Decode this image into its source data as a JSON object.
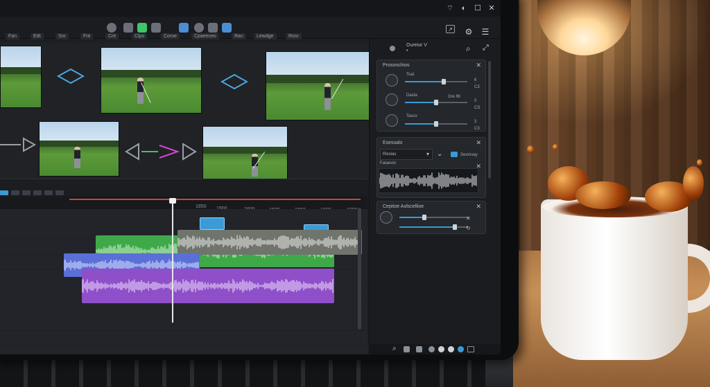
{
  "window": {
    "controls": {
      "wifi": "⌔",
      "theme": "◐",
      "maximize": "☐",
      "close": "✕"
    }
  },
  "toolbar": {
    "tools": [
      "pin-icon",
      "clip-icon",
      "timeline-icon",
      "cloud-icon",
      "image-icon",
      "gear-icon",
      "monitor-icon"
    ],
    "right_icons": [
      "export-icon",
      "settings-icon",
      "menu-icon"
    ]
  },
  "menu": {
    "items": [
      "Fan",
      "Edt",
      "Snr",
      "Fnt",
      "Cre",
      "Clpo",
      "Coroe",
      "Cpaeeceo",
      "Ran",
      "Lewdge",
      "Rosr"
    ]
  },
  "timeline": {
    "ticks": [
      "1850",
      "1900",
      "1600",
      "1500",
      "1650",
      "1600",
      "1000"
    ]
  },
  "panel": {
    "header_label": "Oureior V",
    "header_sub": "•",
    "presets": {
      "title": "Prosonchios",
      "rows": [
        {
          "label": "Toal",
          "value": "6",
          "sub": "C3",
          "level": 0.62
        },
        {
          "label": "Dasta",
          "value": "0",
          "sub": "CS",
          "extra": "Gre fitl",
          "level": 0.5
        },
        {
          "label": "Tasco",
          "value": "3",
          "sub": "C3",
          "level": 0.5
        }
      ]
    },
    "effects": {
      "title": "Esessalo",
      "dropdown_label": "Rissias",
      "dropdown_tag": "Sexmsey",
      "wave_label": "Fataevio"
    },
    "caption": {
      "title": "Cepitoe Aolscellioe",
      "sliders": [
        0.36,
        0.8
      ]
    }
  },
  "colors": {
    "accent": "#3a9bd6",
    "green_track": "#3fa94a",
    "blue_track": "#5a6fd8",
    "purple_track": "#8f4fc9",
    "playhead_red": "#d0443a"
  }
}
